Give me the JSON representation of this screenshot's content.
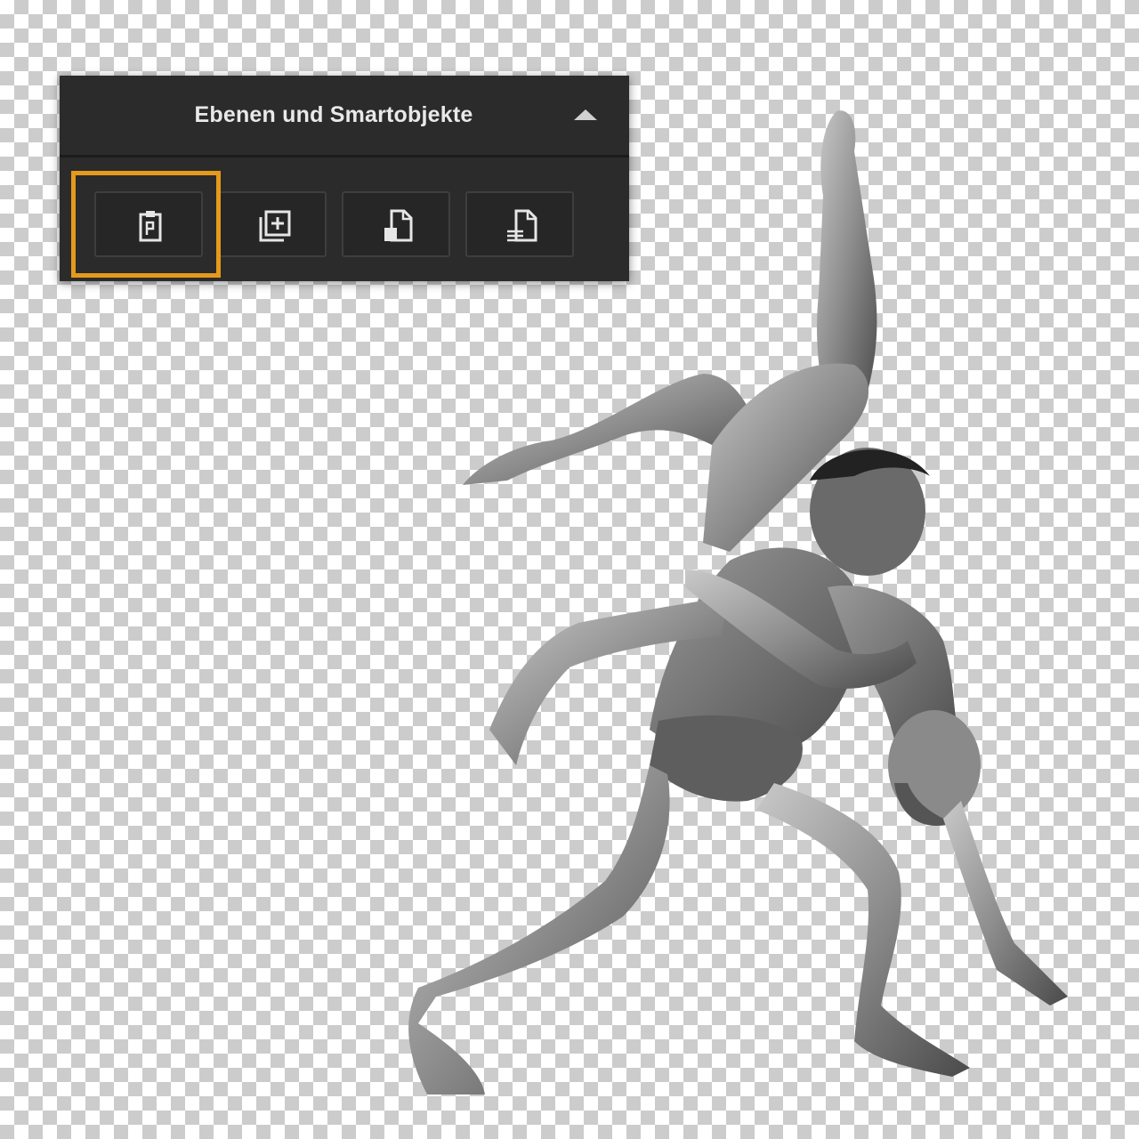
{
  "panel": {
    "title": "Ebenen und Smartobjekte",
    "toggle_icon": "triangle-up-icon",
    "buttons": [
      {
        "icon": "paste-clipboard-icon"
      },
      {
        "icon": "add-layer-icon"
      },
      {
        "icon": "new-document-icon"
      },
      {
        "icon": "document-lines-icon"
      }
    ]
  },
  "colors": {
    "panel_bg": "#2b2b2b",
    "highlight": "#e59a1c",
    "title_text": "#e9e9e9"
  }
}
